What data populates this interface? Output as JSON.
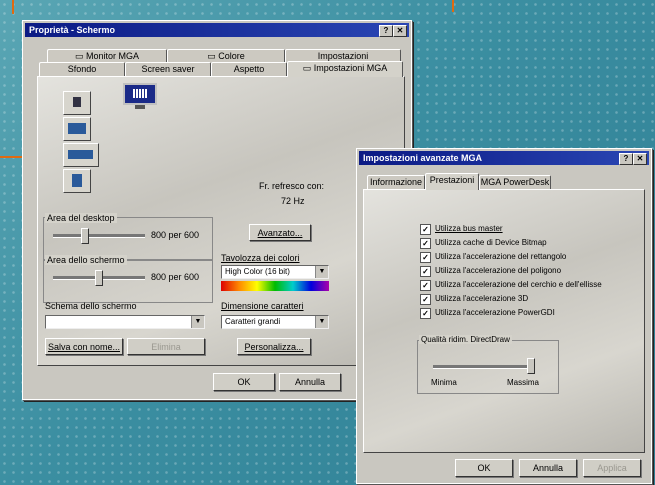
{
  "back_window": {
    "title": "Proprietà - Schermo",
    "close_label": "✕",
    "help_label": "?",
    "tabs_row1": [
      "Monitor MGA",
      "Colore",
      "Impostazioni"
    ],
    "tabs_row2": [
      "Sfondo",
      "Screen saver",
      "Aspetto",
      "Impostazioni MGA"
    ],
    "freq_label": "Fr. refresco con:",
    "freq_value": "72 Hz",
    "avanzato_label": "Avanzato...",
    "desktop_area_label": "Area del desktop",
    "desktop_area_value": "800 per 600",
    "screen_area_label": "Area dello schermo",
    "screen_area_value": "800 per 600",
    "palette_label": "Tavolozza dei colori",
    "palette_value": "High Color (16 bit)",
    "scheme_label": "Schema dello schermo",
    "scheme_value": "",
    "font_size_label": "Dimensione caratteri",
    "font_size_value": "Caratteri grandi",
    "save_label": "Salva con nome...",
    "delete_label": "Elimina",
    "personalize_label": "Personalizza...",
    "ok_label": "OK",
    "cancel_label": "Annulla"
  },
  "front_window": {
    "title": "Impostazioni avanzate MGA",
    "help_label": "?",
    "close_label": "✕",
    "tabs": [
      "Informazione",
      "Prestazioni",
      "MGA PowerDesk"
    ],
    "checkboxes": [
      {
        "label": "Utilizza bus master",
        "checked": true
      },
      {
        "label": "Utilizza cache di Device Bitmap",
        "checked": true
      },
      {
        "label": "Utilizza l'accelerazione del rettangolo",
        "checked": true
      },
      {
        "label": "Utilizza l'accelerazione del poligono",
        "checked": true
      },
      {
        "label": "Utilizza l'accelerazione del cerchio e dell'ellisse",
        "checked": true
      },
      {
        "label": "Utilizza l'accelerazione 3D",
        "checked": true
      },
      {
        "label": "Utilizza l'accelerazione PowerGDI",
        "checked": true
      }
    ],
    "quality_label": "Qualità ridim. DirectDraw",
    "quality_min": "Minima",
    "quality_max": "Massima",
    "ok_label": "OK",
    "cancel_label": "Annulla",
    "apply_label": "Applica"
  }
}
